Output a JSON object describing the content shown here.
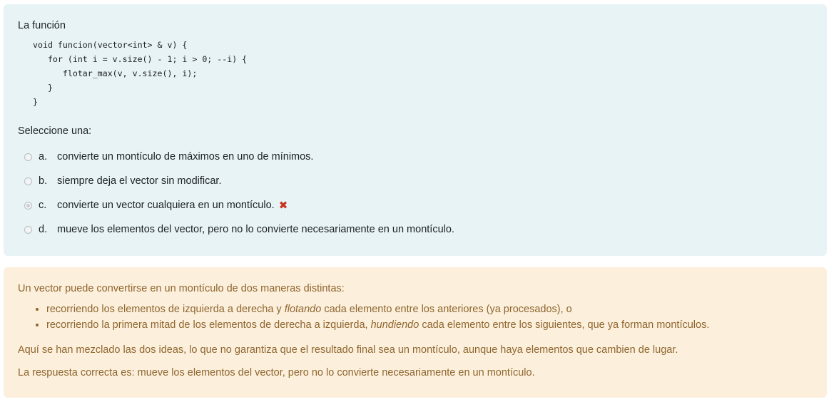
{
  "question": {
    "text": "La función",
    "code_lines": [
      "void funcion(vector<int> & v) {",
      "   for (int i = v.size() - 1; i > 0; --i) {",
      "      flotar_max(v, v.size(), i);",
      "   }",
      "}"
    ],
    "prompt": "Seleccione una:",
    "answers": [
      {
        "letter": "a.",
        "text": "convierte un montículo de máximos en uno de mínimos.",
        "selected": false
      },
      {
        "letter": "b.",
        "text": "siempre deja el vector sin modificar.",
        "selected": false
      },
      {
        "letter": "c.",
        "text": "convierte un vector cualquiera en un montículo.",
        "selected": true,
        "feedback_icon": "incorrect-x-icon",
        "feedback_symbol": "✖"
      },
      {
        "letter": "d.",
        "text": "mueve los elementos del vector, pero no lo convierte necesariamente en un montículo.",
        "selected": false
      }
    ],
    "colors": {
      "question_bg": "#e7f3f5",
      "incorrect": "#ca3120"
    }
  },
  "feedback": {
    "intro": "Un vector puede convertirse en un montículo de dos maneras distintas:",
    "bullets": [
      {
        "before": "recorriendo los elementos de izquierda a derecha y ",
        "em": "flotando",
        "after": " cada elemento entre los anteriores (ya procesados), o"
      },
      {
        "before": "recorriendo la primera mitad de los elementos de derecha a izquierda, ",
        "em": "hundiendo",
        "after": " cada elemento entre los siguientes, que ya forman montículos."
      }
    ],
    "explanation": "Aquí se han mezclado las dos ideas, lo que no garantiza que el resultado final sea un montículo, aunque haya elementos que cambien de lugar.",
    "correct_answer": "La respuesta correcta es: mueve los elementos del vector, pero no lo convierte necesariamente en un montículo.",
    "colors": {
      "feedback_bg": "#fcefdc",
      "feedback_text": "#8e662e"
    }
  }
}
